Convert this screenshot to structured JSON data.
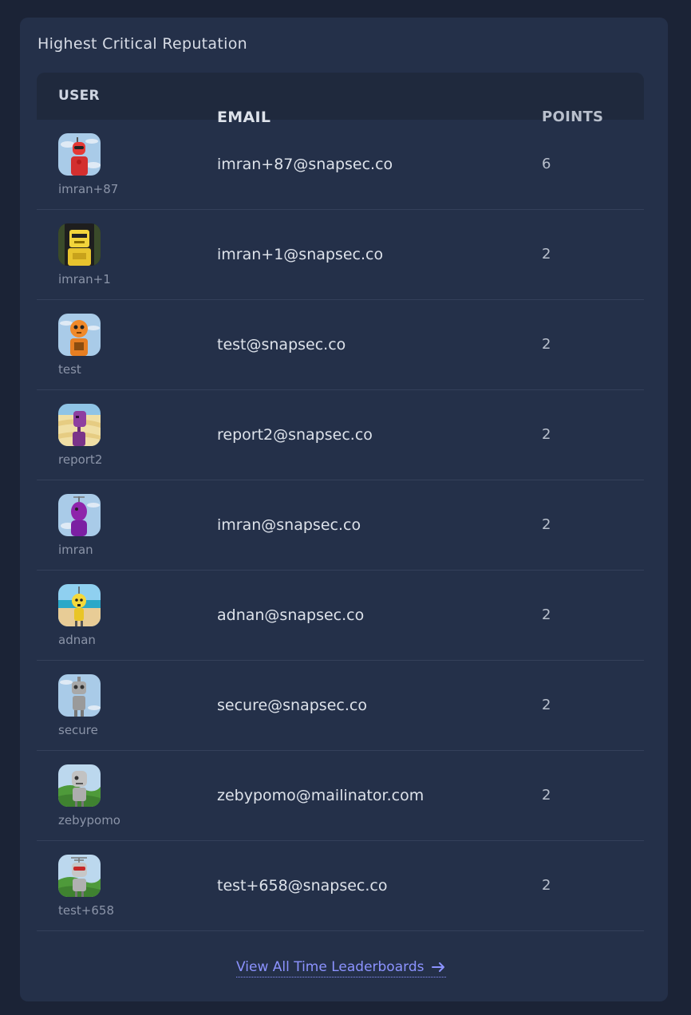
{
  "panel": {
    "title": "Highest Critical Reputation"
  },
  "table": {
    "headers": {
      "user": "USER",
      "email": "EMAIL",
      "points": "POINTS"
    },
    "rows": [
      {
        "username": "imran+87",
        "email": "imran+87@snapsec.co",
        "points": "6",
        "avatar": "red-robot-avatar"
      },
      {
        "username": "imran+1",
        "email": "imran+1@snapsec.co",
        "points": "2",
        "avatar": "yellow-robot-avatar"
      },
      {
        "username": "test",
        "email": "test@snapsec.co",
        "points": "2",
        "avatar": "orange-robot-avatar"
      },
      {
        "username": "report2",
        "email": "report2@snapsec.co",
        "points": "2",
        "avatar": "purple-robot-avatar"
      },
      {
        "username": "imran",
        "email": "imran@snapsec.co",
        "points": "2",
        "avatar": "purple-robot-avatar"
      },
      {
        "username": "adnan",
        "email": "adnan@snapsec.co",
        "points": "2",
        "avatar": "yellow-robot-avatar"
      },
      {
        "username": "secure",
        "email": "secure@snapsec.co",
        "points": "2",
        "avatar": "grey-robot-avatar"
      },
      {
        "username": "zebypomo",
        "email": "zebypomo@mailinator.com",
        "points": "2",
        "avatar": "grey-robot-avatar"
      },
      {
        "username": "test+658",
        "email": "test+658@snapsec.co",
        "points": "2",
        "avatar": "grey-robot-avatar"
      }
    ]
  },
  "footer": {
    "link_label": "View All Time Leaderboards",
    "link_icon": "arrow-right-icon"
  },
  "colors": {
    "page_bg": "#1b2336",
    "card_bg": "#243049",
    "header_bg": "#1f293d",
    "link": "#8c93ff"
  }
}
